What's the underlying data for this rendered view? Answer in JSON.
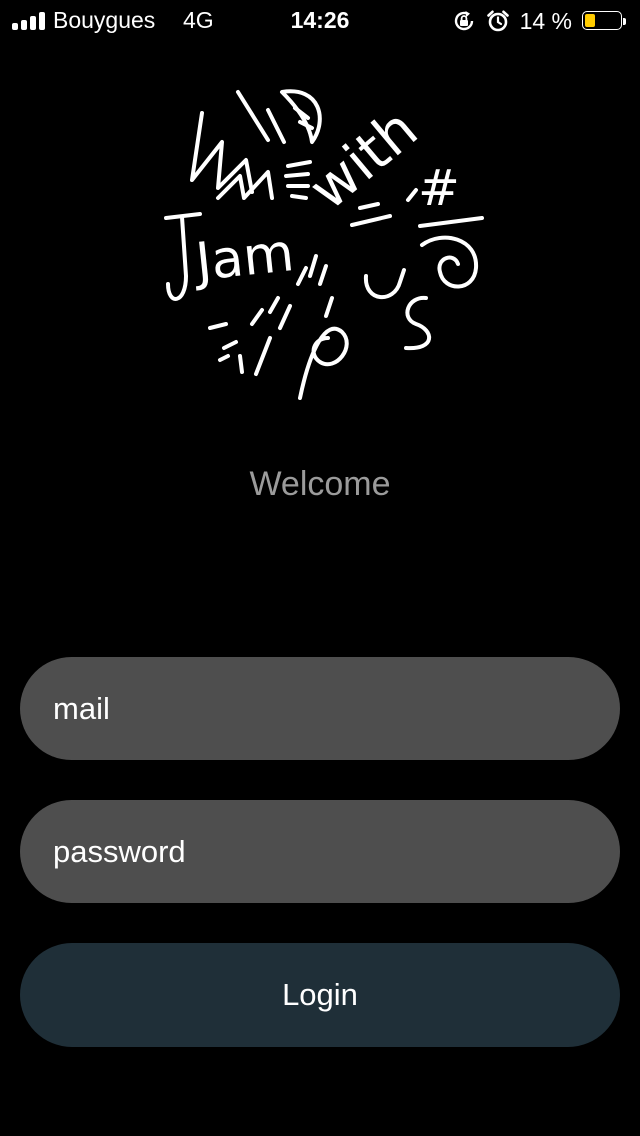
{
  "status_bar": {
    "carrier": "Bouygues",
    "network": "4G",
    "time": "14:26",
    "battery_text": "14 %",
    "battery_level": 0.14,
    "battery_color": "#ffcc00",
    "icons": [
      "signal-icon",
      "rotation-lock-icon",
      "alarm-icon",
      "battery-icon"
    ]
  },
  "logo": {
    "words": [
      "Jam",
      "with",
      "us",
      "#"
    ]
  },
  "welcome_text": "Welcome",
  "form": {
    "mail_placeholder": "mail",
    "password_placeholder": "password",
    "login_label": "Login"
  },
  "colors": {
    "background": "#000000",
    "field": "#4e4e4e",
    "button": "#1f2f38",
    "welcome": "#9b9b9b"
  }
}
